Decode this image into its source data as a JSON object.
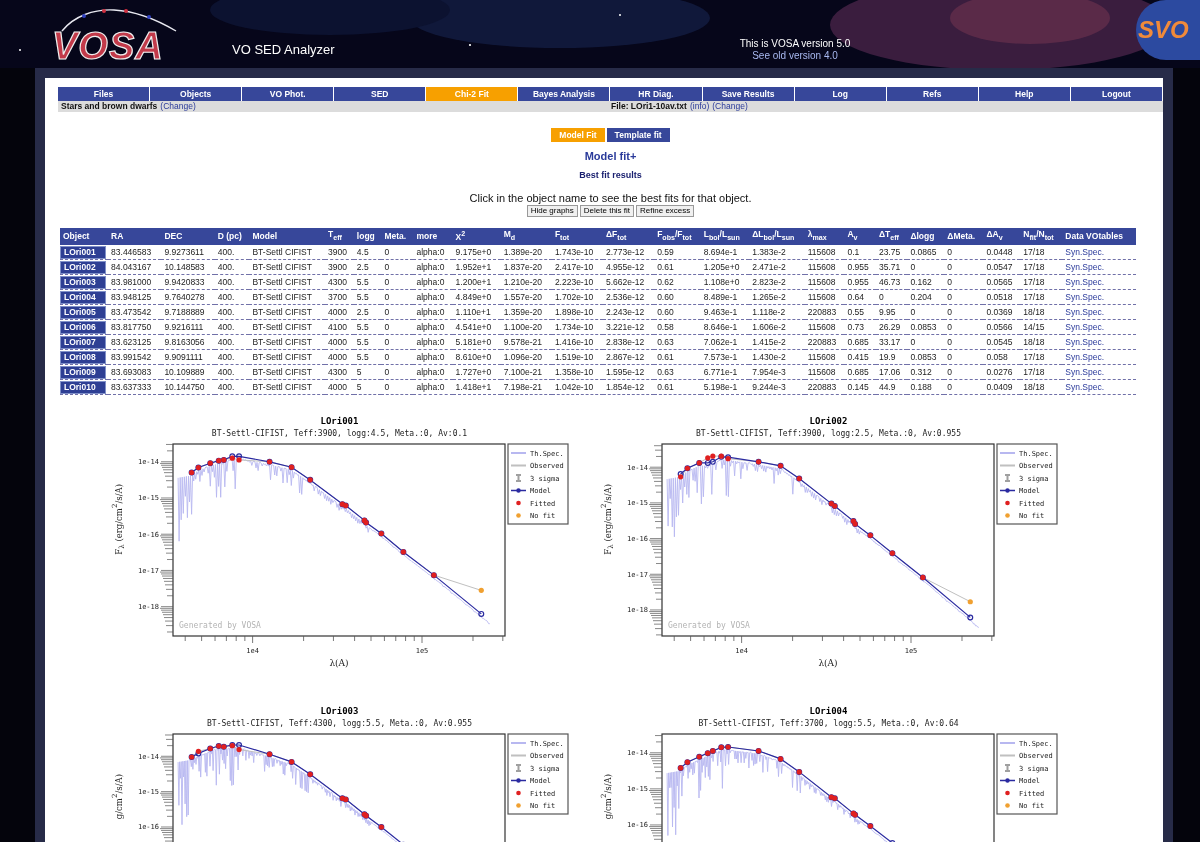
{
  "header": {
    "logo": "VOSA",
    "app_name": "VO SED Analyzer",
    "version": "This is VOSA version 5.0",
    "old_version_link": "See old version 4.0",
    "org_logo": "SVO"
  },
  "nav": [
    {
      "label": "Files",
      "selected": false
    },
    {
      "label": "Objects",
      "selected": false
    },
    {
      "label": "VO Phot.",
      "selected": false
    },
    {
      "label": "SED",
      "selected": false
    },
    {
      "label": "Chi-2 Fit",
      "selected": true
    },
    {
      "label": "Bayes Analysis",
      "selected": false
    },
    {
      "label": "HR Diag.",
      "selected": false
    },
    {
      "label": "Save Results",
      "selected": false
    },
    {
      "label": "Log",
      "selected": false
    },
    {
      "label": "Refs",
      "selected": false
    },
    {
      "label": "Help",
      "selected": false
    },
    {
      "label": "Logout",
      "selected": false
    }
  ],
  "context": {
    "category": "Stars and brown dwarfs",
    "category_link": "(Change)",
    "file": "File: LOri1-10av.txt",
    "info_link": "(info)",
    "file_link": "(Change)"
  },
  "subtabs": [
    {
      "label": "Model Fit",
      "selected": true
    },
    {
      "label": "Template fit",
      "selected": false
    }
  ],
  "heading": "Model fit+",
  "subheading": "Best fit results",
  "instruction": "Click in the object name to see the best fits for that object.",
  "buttons": [
    "Hide graphs",
    "Delete this fit",
    "Refine excess"
  ],
  "table": {
    "columns": [
      "Object",
      "RA",
      "DEC",
      "D (pc)",
      "Model",
      "T$_{eff}$",
      "logg",
      "Meta.",
      "more",
      "X$^{2}$",
      "M$_{d}$",
      "F$_{tot}$",
      "ΔF$_{tot}$",
      "F$_{obs}$/F$_{tot}$",
      "L$_{bol}$/L$_{sun}$",
      "ΔL$_{bol}$/L$_{sun}$",
      "λ$_{max}$",
      "A$_{v}$",
      "ΔT$_{eff}$",
      "Δlogg",
      "ΔMeta.",
      "ΔA$_{v}$",
      "N$_{fit}$/N$_{tot}$",
      "Data VOtables"
    ],
    "rows": [
      {
        "cells": [
          "LOri001",
          "83.446583",
          "9.9273611",
          "400.",
          "BT-Settl CIFIST",
          "3900",
          "4.5",
          "0",
          "alpha:0",
          "9.175e+0",
          "1.389e-20",
          "1.743e-10",
          "2.773e-12",
          "0.59",
          "8.694e-1",
          "1.383e-2",
          "115608",
          "0.1",
          "23.75",
          "0.0865",
          "0",
          "0.0448",
          "17/18",
          "Syn.Spec."
        ]
      },
      {
        "cells": [
          "LOri002",
          "84.043167",
          "10.148583",
          "400.",
          "BT-Settl CIFIST",
          "3900",
          "2.5",
          "0",
          "alpha:0",
          "1.952e+1",
          "1.837e-20",
          "2.417e-10",
          "4.955e-12",
          "0.61",
          "1.205e+0",
          "2.471e-2",
          "115608",
          "0.955",
          "35.71",
          "0",
          "0",
          "0.0547",
          "17/18",
          "Syn.Spec."
        ]
      },
      {
        "cells": [
          "LOri003",
          "83.981000",
          "9.9420833",
          "400.",
          "BT-Settl CIFIST",
          "4300",
          "5.5",
          "0",
          "alpha:0",
          "1.200e+1",
          "1.210e-20",
          "2.223e-10",
          "5.662e-12",
          "0.62",
          "1.108e+0",
          "2.823e-2",
          "115608",
          "0.955",
          "46.73",
          "0.162",
          "0",
          "0.0565",
          "17/18",
          "Syn.Spec."
        ]
      },
      {
        "cells": [
          "LOri004",
          "83.948125",
          "9.7640278",
          "400.",
          "BT-Settl CIFIST",
          "3700",
          "5.5",
          "0",
          "alpha:0",
          "4.849e+0",
          "1.557e-20",
          "1.702e-10",
          "2.536e-12",
          "0.60",
          "8.489e-1",
          "1.265e-2",
          "115608",
          "0.64",
          "0",
          "0.204",
          "0",
          "0.0518",
          "17/18",
          "Syn.Spec."
        ]
      },
      {
        "cells": [
          "LOri005",
          "83.473542",
          "9.7188889",
          "400.",
          "BT-Settl CIFIST",
          "4000",
          "2.5",
          "0",
          "alpha:0",
          "1.110e+1",
          "1.359e-20",
          "1.898e-10",
          "2.243e-12",
          "0.60",
          "9.463e-1",
          "1.118e-2",
          "220883",
          "0.55",
          "9.95",
          "0",
          "0",
          "0.0369",
          "18/18",
          "Syn.Spec."
        ]
      },
      {
        "cells": [
          "LOri006",
          "83.817750",
          "9.9216111",
          "400.",
          "BT-Settl CIFIST",
          "4100",
          "5.5",
          "0",
          "alpha:0",
          "4.541e+0",
          "1.100e-20",
          "1.734e-10",
          "3.221e-12",
          "0.58",
          "8.646e-1",
          "1.606e-2",
          "115608",
          "0.73",
          "26.29",
          "0.0853",
          "0",
          "0.0566",
          "14/15",
          "Syn.Spec."
        ]
      },
      {
        "cells": [
          "LOri007",
          "83.623125",
          "9.8163056",
          "400.",
          "BT-Settl CIFIST",
          "4000",
          "5.5",
          "0",
          "alpha:0",
          "5.181e+0",
          "9.578e-21",
          "1.416e-10",
          "2.838e-12",
          "0.63",
          "7.062e-1",
          "1.415e-2",
          "220883",
          "0.685",
          "33.17",
          "0",
          "0",
          "0.0545",
          "18/18",
          "Syn.Spec."
        ]
      },
      {
        "cells": [
          "LOri008",
          "83.991542",
          "9.9091111",
          "400.",
          "BT-Settl CIFIST",
          "4000",
          "5.5",
          "0",
          "alpha:0",
          "8.610e+0",
          "1.096e-20",
          "1.519e-10",
          "2.867e-12",
          "0.61",
          "7.573e-1",
          "1.430e-2",
          "115608",
          "0.415",
          "19.9",
          "0.0853",
          "0",
          "0.058",
          "17/18",
          "Syn.Spec."
        ]
      },
      {
        "cells": [
          "LOri009",
          "83.693083",
          "10.109889",
          "400.",
          "BT-Settl CIFIST",
          "4300",
          "5",
          "0",
          "alpha:0",
          "1.727e+0",
          "7.100e-21",
          "1.358e-10",
          "1.595e-12",
          "0.63",
          "6.771e-1",
          "7.954e-3",
          "115608",
          "0.685",
          "17.06",
          "0.312",
          "0",
          "0.0276",
          "17/18",
          "Syn.Spec."
        ]
      },
      {
        "cells": [
          "LOri010",
          "83.637333",
          "10.144750",
          "400.",
          "BT-Settl CIFIST",
          "4000",
          "5",
          "0",
          "alpha:0",
          "1.418e+1",
          "7.198e-21",
          "1.042e-10",
          "1.854e-12",
          "0.61",
          "5.198e-1",
          "9.244e-3",
          "220883",
          "0.145",
          "44.9",
          "0.188",
          "0",
          "0.0409",
          "18/18",
          "Syn.Spec."
        ]
      }
    ]
  },
  "plots": [
    {
      "title": "LOri001",
      "subtitle": "BT-Settl-CIFIST, Teff:3900, logg:4.5, Meta.:0, Av:0.1",
      "ylabel": "F$_{λ}$ (erg/cm$^{2}$/s/A)",
      "y_tick_labels": [
        "1e-14",
        "1e-15",
        "1e-16",
        "1e-17",
        "1e-18"
      ],
      "x_tick_labels": [
        "1e4",
        "1e5"
      ],
      "xlabel": "λ(A)",
      "watermark": "Generated by VOSA",
      "legend": [
        {
          "label": "Th.Spec.",
          "kind": "spectrum",
          "color": "#b8b8f0"
        },
        {
          "label": "Observed",
          "kind": "line",
          "color": "#c0c0c0"
        },
        {
          "label": "3 sigma",
          "kind": "errorbar",
          "color": "#a0a0a0"
        },
        {
          "label": "Model",
          "kind": "model",
          "color": "#2a2aa0"
        },
        {
          "label": "Fitted",
          "kind": "point",
          "color": "#e02020"
        },
        {
          "label": "No fit",
          "kind": "point",
          "color": "#f0a030"
        }
      ]
    },
    {
      "title": "LOri002",
      "subtitle": "BT-Settl-CIFIST, Teff:3900, logg:2.5, Meta.:0, Av:0.955",
      "ylabel": "F$_{λ}$ (erg/cm$^{2}$/s/A)",
      "y_tick_labels": [
        "1e-14",
        "1e-15",
        "1e-16",
        "1e-17",
        "1e-18"
      ],
      "x_tick_labels": [
        "1e4",
        "1e5"
      ],
      "xlabel": "λ(A)",
      "watermark": "Generated by VOSA",
      "legend": [
        {
          "label": "Th.Spec.",
          "kind": "spectrum",
          "color": "#b8b8f0"
        },
        {
          "label": "Observed",
          "kind": "line",
          "color": "#c0c0c0"
        },
        {
          "label": "3 sigma",
          "kind": "errorbar",
          "color": "#a0a0a0"
        },
        {
          "label": "Model",
          "kind": "model",
          "color": "#2a2aa0"
        },
        {
          "label": "Fitted",
          "kind": "point",
          "color": "#e02020"
        },
        {
          "label": "No fit",
          "kind": "point",
          "color": "#f0a030"
        }
      ]
    },
    {
      "title": "LOri003",
      "subtitle": "BT-Settl-CIFIST, Teff:4300, logg:5.5, Meta.:0, Av:0.955",
      "ylabel": "g/cm$^{2}$/s/A)",
      "y_tick_labels": [
        "1e-14",
        "1e-15",
        "1e-16"
      ],
      "legend": [
        {
          "label": "Th.Spec.",
          "kind": "spectrum",
          "color": "#b8b8f0"
        },
        {
          "label": "Observed",
          "kind": "line",
          "color": "#c0c0c0"
        },
        {
          "label": "3 sigma",
          "kind": "errorbar",
          "color": "#a0a0a0"
        },
        {
          "label": "Model",
          "kind": "model",
          "color": "#2a2aa0"
        },
        {
          "label": "Fitted",
          "kind": "point",
          "color": "#e02020"
        },
        {
          "label": "No fit",
          "kind": "point",
          "color": "#f0a030"
        }
      ]
    },
    {
      "title": "LOri004",
      "subtitle": "BT-Settl-CIFIST, Teff:3700, logg:5.5, Meta.:0, Av:0.64",
      "ylabel": "g/cm$^{2}$/s/A)",
      "y_tick_labels": [
        "1e-14",
        "1e-15",
        "1e-16"
      ],
      "legend": [
        {
          "label": "Th.Spec.",
          "kind": "spectrum",
          "color": "#b8b8f0"
        },
        {
          "label": "Observed",
          "kind": "line",
          "color": "#c0c0c0"
        },
        {
          "label": "3 sigma",
          "kind": "errorbar",
          "color": "#a0a0a0"
        },
        {
          "label": "Model",
          "kind": "model",
          "color": "#2a2aa0"
        },
        {
          "label": "Fitted",
          "kind": "point",
          "color": "#e02020"
        },
        {
          "label": "No fit",
          "kind": "point",
          "color": "#f0a030"
        }
      ]
    }
  ]
}
